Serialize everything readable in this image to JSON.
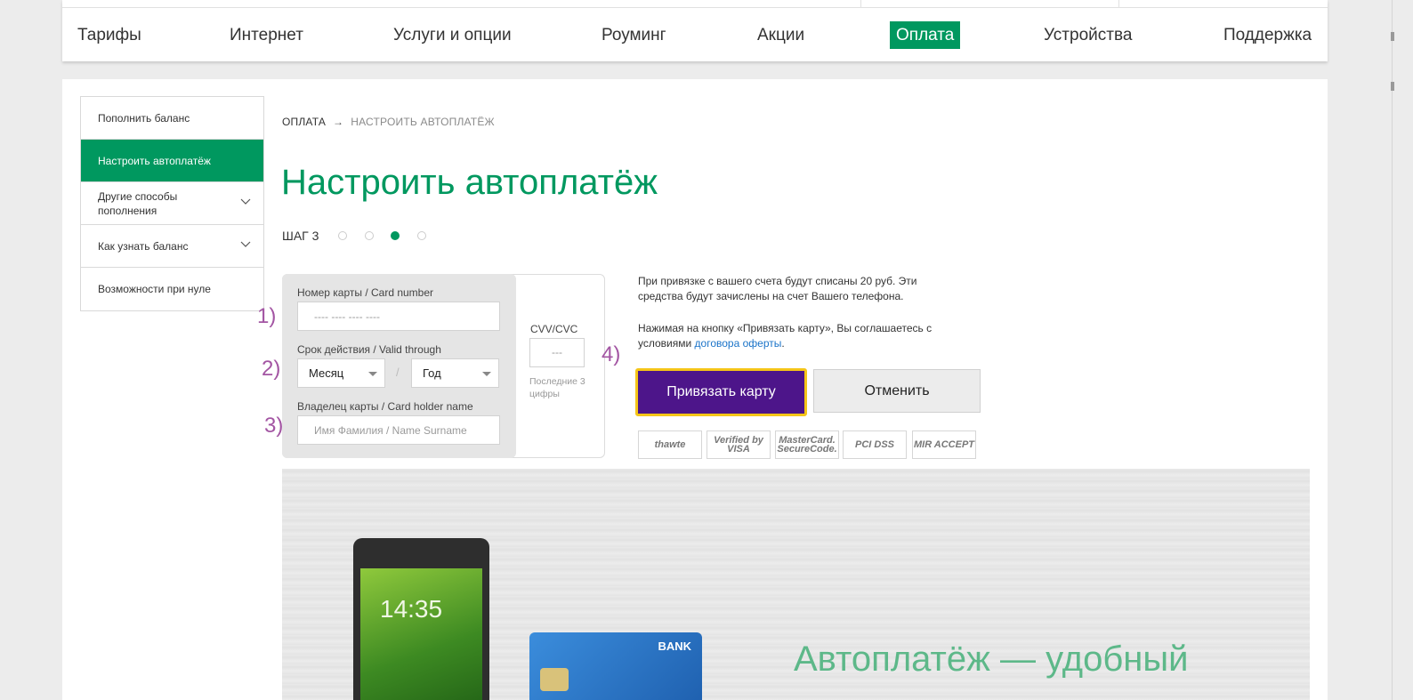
{
  "nav": {
    "items": [
      {
        "label": "Тарифы",
        "active": false
      },
      {
        "label": "Интернет",
        "active": false
      },
      {
        "label": "Услуги и опции",
        "active": false
      },
      {
        "label": "Роуминг",
        "active": false
      },
      {
        "label": "Акции",
        "active": false
      },
      {
        "label": "Оплата",
        "active": true
      },
      {
        "label": "Устройства",
        "active": false
      },
      {
        "label": "Поддержка",
        "active": false
      }
    ]
  },
  "sidebar": {
    "items": [
      {
        "label": "Пополнить баланс",
        "active": false,
        "expandable": false
      },
      {
        "label": "Настроить автоплатёж",
        "active": true,
        "expandable": false
      },
      {
        "label": "Другие способы пополнения",
        "active": false,
        "expandable": true
      },
      {
        "label": "Как узнать баланс",
        "active": false,
        "expandable": true
      },
      {
        "label": "Возможности при нуле",
        "active": false,
        "expandable": false
      }
    ]
  },
  "breadcrumb": {
    "first": "ОПЛАТА",
    "arrow": "→",
    "second": "НАСТРОИТЬ АВТОПЛАТЁЖ"
  },
  "page_title": "Настроить автоплатёж",
  "steps": {
    "label": "ШАГ 3",
    "total": 4,
    "current": 3
  },
  "form": {
    "card_number_label": "Номер карты / Card number",
    "card_number_placeholder": "---- ---- ---- ----",
    "expiry_label": "Срок действия / Valid through",
    "month_value": "Месяц",
    "slash": "/",
    "year_value": "Год",
    "holder_label": "Владелец карты / Card holder name",
    "holder_placeholder": "Имя Фамилия / Name Surname",
    "cvv_label": "CVV/CVC",
    "cvv_placeholder": "---",
    "cvv_hint": "Последние 3 цифры"
  },
  "annotations": [
    "1)",
    "2)",
    "3)",
    "4)"
  ],
  "info": {
    "text1": "При привязке с вашего счета будут списаны 20 руб. Эти средства будут зачислены на счет Вашего телефона.",
    "text2_before": "Нажимая на кнопку «Привязать карту», Вы соглашаетесь с условиями ",
    "text2_link": "договора оферты",
    "text2_after": "."
  },
  "buttons": {
    "bind": "Привязать карту",
    "cancel": "Отменить"
  },
  "badges": [
    "thawte",
    "Verified by VISA",
    "MasterCard. SecureCode.",
    "PCI DSS",
    "MIR ACCEPT"
  ],
  "promo": {
    "title": "Автоплатёж — удобный",
    "phone_time": "14:35",
    "card_bank": "BANK"
  },
  "colors": {
    "brand_green": "#00985f",
    "bind_button": "#4d158a",
    "button_outline": "#f5c518",
    "annotation": "#a355a3",
    "link": "#1a73c8"
  }
}
